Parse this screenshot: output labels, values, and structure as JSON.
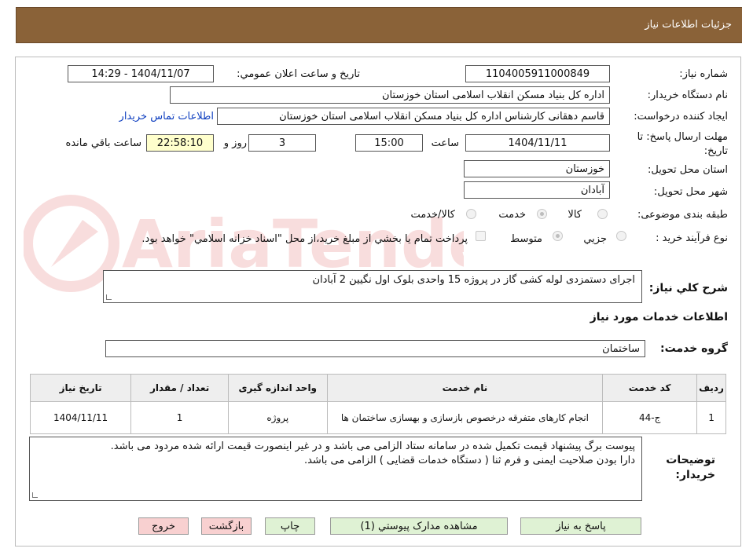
{
  "header": {
    "title": "جزئیات اطلاعات نیاز"
  },
  "fields": {
    "need_number_label": "شماره نیاز:",
    "need_number": "1104005911000849",
    "announce_label": "تاریخ و ساعت اعلان عمومي:",
    "announce_value": "1404/11/07 - 14:29",
    "buyer_org_label": "نام دستگاه خريدار:",
    "buyer_org": "اداره کل بنیاد مسکن انقلاب اسلامی استان خوزستان",
    "requester_label": "ايجاد کننده درخواست:",
    "requester": "قاسم دهقانی کارشناس اداره کل بنیاد مسکن انقلاب اسلامی استان خوزستان",
    "contact_link": "اطلاعات تماس خريدار",
    "deadline_label": "مهلت ارسال پاسخ: تا تاريخ:",
    "deadline_date": "1404/11/11",
    "time_label": "ساعت",
    "deadline_time": "15:00",
    "days_value": "3",
    "days_label": "روز و",
    "remaining_time": "22:58:10",
    "remaining_label": "ساعت باقي مانده",
    "province_label": "استان محل تحويل:",
    "province": "خوزستان",
    "city_label": "شهر محل تحويل:",
    "city": "آبادان",
    "category_label": "طبقه بندی موضوعی:",
    "category_options": [
      "کالا",
      "خدمت",
      "کالا/خدمت"
    ],
    "category_selected": "خدمت",
    "process_label": "نوع فرآيند خريد :",
    "process_options": [
      "جزیي",
      "متوسط"
    ],
    "process_selected": "متوسط",
    "payment_note": "پرداخت تمام يا بخشي از مبلغ خريد،از محل \"اسناد خزانه اسلامي\" خواهد بود."
  },
  "description": {
    "label": "شرح كلي نياز:",
    "text": "اجرای دستمزدی لوله کشی گاز در  پروژه  15 واحدی بلوک اول نگیین 2 آبادان"
  },
  "services": {
    "section_title": "اطلاعات خدمات مورد نياز",
    "group_label": "گروه خدمت:",
    "group_value": "ساختمان",
    "columns": [
      "رديف",
      "کد خدمت",
      "نام خدمت",
      "واحد اندازه گيری",
      "تعداد / مقدار",
      "تاريخ نياز"
    ],
    "rows": [
      {
        "row": "1",
        "code": "ج-44",
        "name": "انجام کارهای متفرقه درخصوص بازسازی و بهسازی ساختمان ها",
        "unit": "پروژه",
        "qty": "1",
        "date": "1404/11/11"
      }
    ]
  },
  "buyer_notes": {
    "label": "توضيحات خريدار:",
    "line1": "پیوست برگ پیشنهاد قیمت تکمیل شده در سامانه ستاد الزامی می باشد و در غیر اینصورت  قیمت ارائه شده مردود می باشد.",
    "line2": "دارا بودن صلاحیت ایمنی و فرم ثنا ( دستگاه خدمات قضایی ) الزامی می باشد."
  },
  "buttons": {
    "reply": "پاسخ به نياز",
    "attachments": "مشاهده مدارک پيوستي (1)",
    "print": "چاپ",
    "back": "بازگشت",
    "exit": "خروج"
  },
  "watermark": {
    "text": "AriaTender.neT"
  },
  "colors": {
    "header_bg": "#8a6238",
    "link": "#1040c0",
    "button_green": "#dff2d4",
    "button_pink": "#f8d0d0",
    "timer_bg": "#ffffcc"
  }
}
